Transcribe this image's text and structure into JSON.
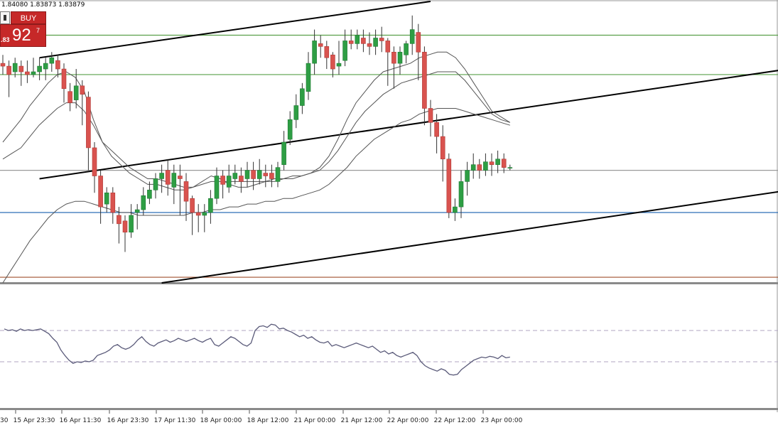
{
  "header": {
    "ohlc_text": "1.84080 1.83873 1.83879",
    "buy_label": "BUY",
    "price_prefix": ".83",
    "price_main": "92",
    "price_sup": "7"
  },
  "colors": {
    "bull": "#2e9e44",
    "bear": "#d9534f",
    "wick": "#333333",
    "ma": "#555555",
    "trendline": "#000000",
    "level_green": "#5aa04a",
    "level_blue": "#2f6fb8",
    "level_red": "#a0522d",
    "level_grey": "#9a9a9a",
    "oscillator": "#5b5b7a",
    "osc_level": "#b0a6c0"
  },
  "chart_data": {
    "type": "candlestick",
    "x_ticks": [
      "15 Apr 23:30",
      "16 Apr 11:30",
      "16 Apr 23:30",
      "17 Apr 11:30",
      "18 Apr 00:00",
      "18 Apr 12:00",
      "21 Apr 00:00",
      "21 Apr 12:00",
      "22 Apr 00:00",
      "22 Apr 12:00",
      "23 Apr 00:00"
    ],
    "x_tick_partial": "30",
    "price_ylim": [
      0,
      100
    ],
    "horizontal_levels": [
      {
        "y": 88,
        "color": "level_green"
      },
      {
        "y": 74,
        "color": "level_green"
      },
      {
        "y": 40,
        "color": "level_grey"
      },
      {
        "y": 25,
        "color": "level_blue"
      },
      {
        "y": 2,
        "color": "level_red"
      }
    ],
    "trendlines": [
      {
        "x1": 6,
        "y1": 80,
        "x2": 70,
        "y2": 100
      },
      {
        "x1": 6,
        "y1": 37,
        "x2": 160,
        "y2": 86
      },
      {
        "x1": 26,
        "y1": 0,
        "x2": 160,
        "y2": 43
      }
    ],
    "candles": [
      [
        78,
        77,
        81,
        74
      ],
      [
        77,
        74,
        79,
        66
      ],
      [
        75,
        78,
        80,
        73
      ],
      [
        77,
        75,
        79,
        70
      ],
      [
        75,
        74,
        79,
        71
      ],
      [
        74,
        75,
        80,
        73
      ],
      [
        75,
        77,
        80,
        72
      ],
      [
        76,
        78,
        80,
        72
      ],
      [
        78,
        80,
        82,
        75
      ],
      [
        79,
        76,
        81,
        73
      ],
      [
        76,
        69,
        78,
        64
      ],
      [
        68,
        64,
        71,
        61
      ],
      [
        65,
        70,
        76,
        62
      ],
      [
        70,
        67,
        72,
        56
      ],
      [
        66,
        48,
        68,
        40
      ],
      [
        48,
        38,
        50,
        32
      ],
      [
        38,
        27,
        40,
        21
      ],
      [
        28,
        32,
        34,
        25
      ],
      [
        32,
        25,
        34,
        21
      ],
      [
        24,
        21,
        27,
        14
      ],
      [
        22,
        18,
        24,
        11
      ],
      [
        18,
        24,
        28,
        16
      ],
      [
        25,
        26,
        28,
        19
      ],
      [
        26,
        31,
        34,
        24
      ],
      [
        30,
        33,
        36,
        28
      ],
      [
        33,
        37,
        39,
        30
      ],
      [
        37,
        39,
        42,
        32
      ],
      [
        40,
        35,
        44,
        31
      ],
      [
        34,
        39,
        42,
        28
      ],
      [
        38,
        37,
        42,
        24
      ],
      [
        36,
        29,
        39,
        22
      ],
      [
        30,
        25,
        31,
        17
      ],
      [
        25,
        24,
        28,
        18
      ],
      [
        24,
        25,
        28,
        18
      ],
      [
        25,
        30,
        33,
        21
      ],
      [
        30,
        38,
        41,
        28
      ],
      [
        38,
        35,
        40,
        30
      ],
      [
        34,
        38,
        42,
        32
      ],
      [
        37,
        39,
        42,
        35
      ],
      [
        38,
        36,
        41,
        32
      ],
      [
        37,
        40,
        43,
        34
      ],
      [
        40,
        37,
        43,
        33
      ],
      [
        37,
        40,
        44,
        35
      ],
      [
        39,
        38,
        42,
        34
      ],
      [
        39,
        37,
        42,
        34
      ],
      [
        36,
        41,
        43,
        34
      ],
      [
        42,
        50,
        54,
        40
      ],
      [
        51,
        58,
        61,
        49
      ],
      [
        58,
        63,
        67,
        55
      ],
      [
        63,
        69,
        71,
        60
      ],
      [
        68,
        78,
        82,
        65
      ],
      [
        78,
        86,
        90,
        74
      ],
      [
        85,
        84,
        88,
        80
      ],
      [
        84,
        80,
        86,
        76
      ],
      [
        81,
        76,
        82,
        73
      ],
      [
        77,
        78,
        86,
        74
      ],
      [
        79,
        86,
        90,
        77
      ],
      [
        86,
        85,
        90,
        83
      ],
      [
        85,
        88,
        90,
        83
      ],
      [
        87,
        85,
        90,
        82
      ],
      [
        85,
        84,
        89,
        81
      ],
      [
        84,
        87,
        90,
        81
      ],
      [
        87,
        86,
        91,
        82
      ],
      [
        86,
        82,
        87,
        70
      ],
      [
        82,
        78,
        84,
        69
      ],
      [
        78,
        82,
        84,
        74
      ],
      [
        81,
        85,
        86,
        78
      ],
      [
        85,
        90,
        95,
        81
      ],
      [
        89,
        82,
        92,
        72
      ],
      [
        82,
        62,
        84,
        56
      ],
      [
        62,
        57,
        65,
        52
      ],
      [
        57,
        52,
        60,
        46
      ],
      [
        52,
        44,
        56,
        36
      ],
      [
        44,
        25,
        46,
        23
      ],
      [
        25,
        27,
        30,
        22
      ],
      [
        27,
        36,
        40,
        23
      ],
      [
        36,
        40,
        43,
        31
      ],
      [
        40,
        42,
        46,
        37
      ],
      [
        42,
        40,
        44,
        37
      ],
      [
        40,
        43,
        46,
        38
      ],
      [
        43,
        42,
        46,
        38
      ],
      [
        42,
        44,
        47,
        39
      ],
      [
        44,
        41,
        46,
        39
      ],
      [
        41,
        41,
        42,
        40
      ]
    ],
    "ma_series": [
      {
        "values": [
          50,
          54,
          58,
          63,
          67,
          71,
          74,
          75,
          73,
          68,
          58,
          50,
          45,
          42,
          39,
          37,
          35,
          35,
          34,
          33,
          33,
          34,
          36,
          38,
          37,
          35,
          34,
          34,
          35,
          36,
          36,
          37,
          37,
          38,
          39,
          41,
          45,
          51,
          58,
          64,
          68,
          72,
          75,
          76,
          77,
          78,
          80,
          81,
          82,
          82,
          80,
          76,
          71,
          66,
          61,
          59,
          57
        ]
      },
      {
        "values": [
          44,
          46,
          48,
          52,
          56,
          59,
          62,
          64,
          64,
          61,
          56,
          50,
          47,
          44,
          41,
          39,
          37,
          37,
          36,
          35,
          34,
          34,
          35,
          36,
          36,
          36,
          36,
          36,
          36,
          36,
          37,
          37,
          38,
          38,
          39,
          40,
          43,
          47,
          52,
          57,
          61,
          64,
          67,
          69,
          71,
          72,
          73,
          74,
          75,
          75,
          75,
          72,
          68,
          64,
          60,
          58,
          57
        ]
      },
      {
        "values": [
          0,
          5,
          10,
          15,
          19,
          23,
          26,
          28,
          29,
          29,
          28,
          27,
          26,
          25,
          25,
          24,
          24,
          24,
          24,
          24,
          24,
          25,
          25,
          26,
          26,
          27,
          27,
          28,
          28,
          29,
          29,
          30,
          30,
          31,
          32,
          33,
          35,
          38,
          41,
          45,
          48,
          51,
          53,
          55,
          57,
          58,
          60,
          61,
          62,
          62,
          62,
          61,
          60,
          59,
          58,
          57,
          56
        ]
      }
    ],
    "oscillator": {
      "ylim": [
        0,
        100
      ],
      "levels": [
        70,
        30
      ],
      "values": [
        72,
        70,
        71,
        69,
        72,
        70,
        71,
        70,
        71,
        72,
        69,
        66,
        60,
        55,
        45,
        38,
        32,
        28,
        30,
        29,
        31,
        30,
        32,
        38,
        40,
        42,
        45,
        50,
        52,
        48,
        46,
        48,
        52,
        58,
        62,
        56,
        52,
        50,
        54,
        56,
        58,
        55,
        57,
        60,
        58,
        56,
        58,
        60,
        57,
        55,
        58,
        60,
        52,
        50,
        54,
        58,
        62,
        60,
        56,
        52,
        50,
        54,
        70,
        75,
        76,
        74,
        78,
        77,
        72,
        73,
        70,
        68,
        65,
        62,
        64,
        60,
        62,
        58,
        55,
        54,
        56,
        50,
        52,
        50,
        48,
        50,
        52,
        54,
        52,
        50,
        48,
        50,
        46,
        42,
        44,
        40,
        42,
        38,
        36,
        38,
        40,
        42,
        38,
        30,
        25,
        22,
        20,
        18,
        21,
        19,
        14,
        13,
        14,
        20,
        24,
        28,
        32,
        34,
        36,
        35,
        37,
        36,
        34,
        38,
        35,
        36
      ]
    }
  }
}
